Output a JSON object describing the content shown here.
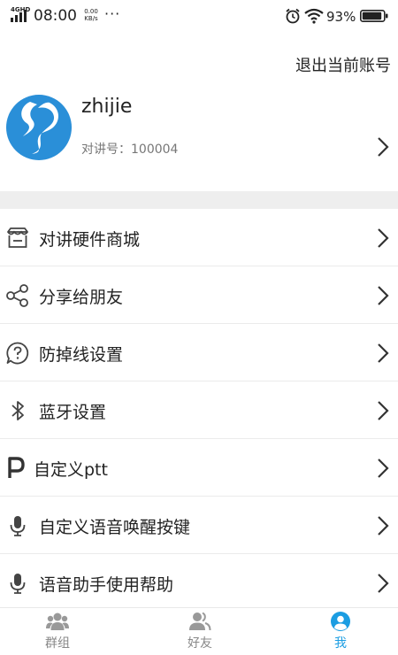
{
  "status_bar": {
    "network": "4GHD",
    "time": "08:00",
    "speed_value": "0.00",
    "speed_unit": "KB/s",
    "more": "···",
    "battery_percent": "93%",
    "battery_level": 0.93
  },
  "header": {
    "logout_label": "退出当前账号"
  },
  "profile": {
    "username": "zhijie",
    "intercom_label": "对讲号：",
    "intercom_number": "100004"
  },
  "menu": {
    "items": [
      {
        "label": "对讲硬件商城",
        "icon": "store-icon"
      },
      {
        "label": "分享给朋友",
        "icon": "share-icon"
      },
      {
        "label": "防掉线设置",
        "icon": "question-bubble-icon"
      },
      {
        "label": "蓝牙设置",
        "icon": "bluetooth-icon"
      },
      {
        "label": "自定义ptt",
        "icon": "letter-p-icon"
      },
      {
        "label": "自定义语音唤醒按键",
        "icon": "microphone-icon"
      },
      {
        "label": "语音助手使用帮助",
        "icon": "microphone-icon"
      }
    ]
  },
  "tabbar": {
    "tabs": [
      {
        "label": "群组",
        "icon": "group-icon",
        "active": false
      },
      {
        "label": "好友",
        "icon": "friends-icon",
        "active": false
      },
      {
        "label": "我",
        "icon": "me-icon",
        "active": true
      }
    ]
  },
  "colors": {
    "accent": "#1b9de2",
    "avatar_blue": "#2a8fd8",
    "divider": "#eeeeee"
  }
}
